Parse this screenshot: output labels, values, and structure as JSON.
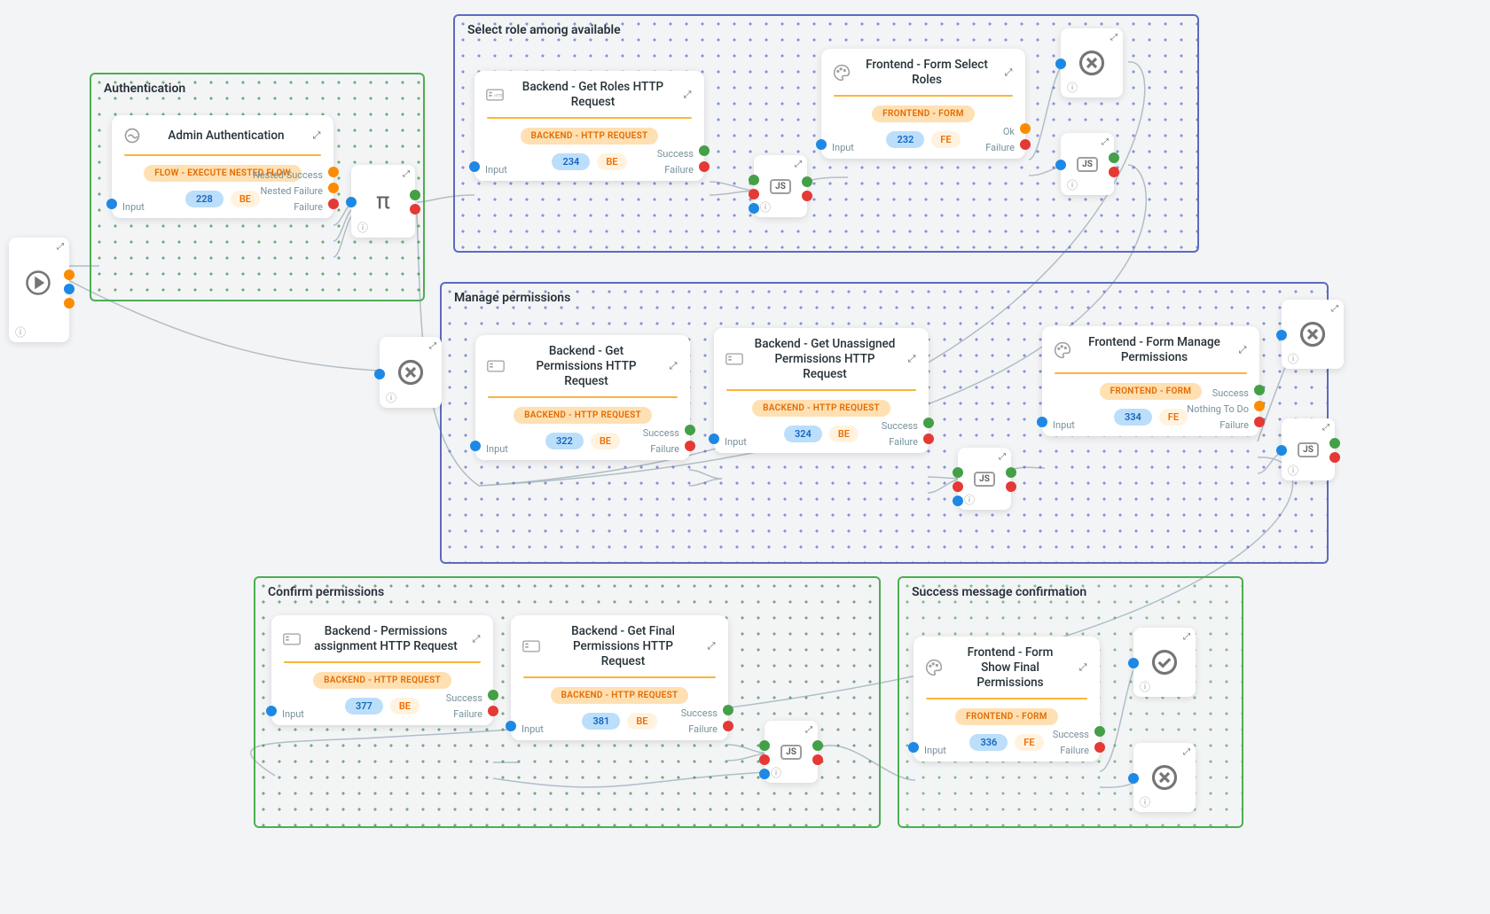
{
  "groups": {
    "authentication": {
      "title": "Authentication"
    },
    "select_role": {
      "title": "Select role among available"
    },
    "manage_permissions": {
      "title": "Manage permissions"
    },
    "confirm_permissions": {
      "title": "Confirm permissions"
    },
    "success_confirmation": {
      "title": "Success message confirmation"
    }
  },
  "nodes": {
    "admin_auth": {
      "title": "Admin Authentication",
      "tag": "FLOW - EXECUTE NESTED FLOW",
      "id": "228",
      "side": "BE",
      "ports": {
        "input": "Input",
        "nested_success": "Nested Success",
        "nested_failure": "Nested Failure",
        "failure": "Failure"
      }
    },
    "get_roles": {
      "title": "Backend - Get Roles HTTP Request",
      "tag": "BACKEND - HTTP REQUEST",
      "id": "234",
      "side": "BE",
      "ports": {
        "input": "Input",
        "success": "Success",
        "failure": "Failure"
      }
    },
    "form_select_roles": {
      "title": "Frontend - Form Select Roles",
      "tag": "FRONTEND - FORM",
      "id": "232",
      "side": "FE",
      "ports": {
        "input": "Input",
        "ok": "Ok",
        "failure": "Failure"
      }
    },
    "get_permissions": {
      "title": "Backend - Get Permissions HTTP Request",
      "tag": "BACKEND - HTTP REQUEST",
      "id": "322",
      "side": "BE",
      "ports": {
        "input": "Input",
        "success": "Success",
        "failure": "Failure"
      }
    },
    "get_unassigned": {
      "title": "Backend - Get Unassigned Permissions HTTP Request",
      "tag": "BACKEND - HTTP REQUEST",
      "id": "324",
      "side": "BE",
      "ports": {
        "input": "Input",
        "success": "Success",
        "failure": "Failure"
      }
    },
    "form_manage": {
      "title": "Frontend - Form Manage Permissions",
      "tag": "FRONTEND - FORM",
      "id": "334",
      "side": "FE",
      "ports": {
        "input": "Input",
        "success": "Success",
        "nothing": "Nothing To Do",
        "failure": "Failure"
      }
    },
    "permissions_assign": {
      "title": "Backend - Permissions assignment HTTP Request",
      "tag": "BACKEND - HTTP REQUEST",
      "id": "377",
      "side": "BE",
      "ports": {
        "input": "Input",
        "success": "Success",
        "failure": "Failure"
      }
    },
    "get_final": {
      "title": "Backend - Get Final Permissions HTTP Request",
      "tag": "BACKEND - HTTP REQUEST",
      "id": "381",
      "side": "BE",
      "ports": {
        "input": "Input",
        "success": "Success",
        "failure": "Failure"
      }
    },
    "form_final": {
      "title": "Frontend - Form Show Final Permissions",
      "tag": "FRONTEND - FORM",
      "id": "336",
      "side": "FE",
      "ports": {
        "input": "Input",
        "success": "Success",
        "failure": "Failure"
      }
    }
  },
  "mini": {
    "pi": "π",
    "js": "JS",
    "close": "✕",
    "check": "✓",
    "info": "ⓘ"
  },
  "colors": {
    "green": "#4caf50",
    "purple": "#5c6bc0",
    "orange_accent": "#fcb43b",
    "port_blue": "#1e88e5",
    "port_green": "#43a047",
    "port_red": "#e53935",
    "port_orange": "#fb8c00"
  }
}
